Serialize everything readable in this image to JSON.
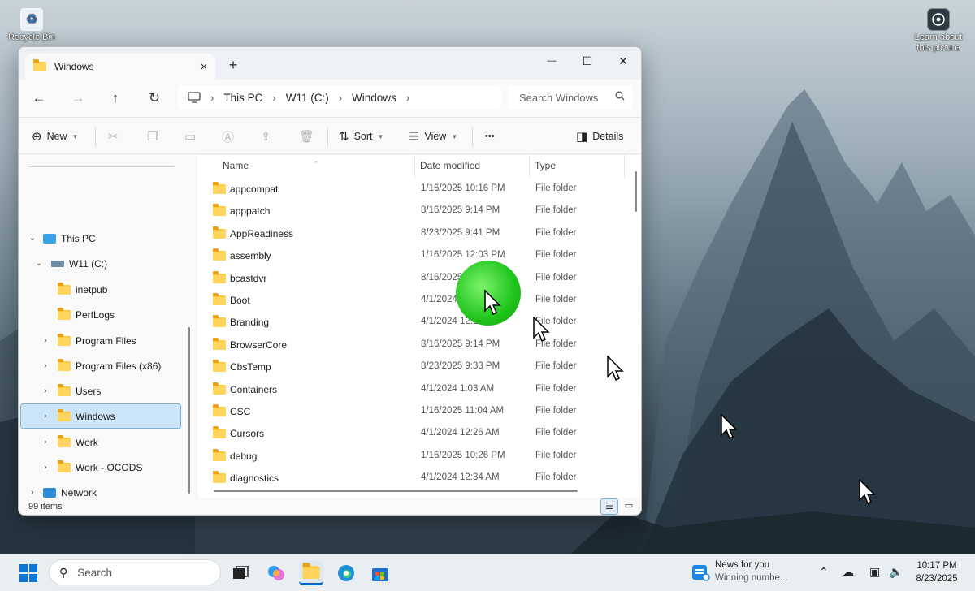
{
  "desktop": {
    "recycle_bin_label": "Recycle Bin",
    "learn_about_label": "Learn about this picture"
  },
  "window": {
    "tab_title": "Windows",
    "new_tab_glyph": "+",
    "tab_close_glyph": "×",
    "minimize_glyph": "—",
    "maximize_glyph": "☐",
    "close_glyph": "✕"
  },
  "nav": {
    "back_glyph": "←",
    "forward_glyph": "→",
    "up_glyph": "↑",
    "refresh_glyph": "↻",
    "breadcrumb": [
      "This PC",
      "W11 (C:)",
      "Windows"
    ],
    "search_placeholder": "Search Windows"
  },
  "toolbar": {
    "new_label": "New",
    "sort_label": "Sort",
    "view_label": "View",
    "more_label": "•••",
    "details_label": "Details"
  },
  "sidebar": {
    "items": [
      {
        "label": "This PC",
        "icon": "pc-icon",
        "expanded": true
      },
      {
        "label": "W11 (C:)",
        "icon": "drive-icon",
        "expanded": true
      },
      {
        "label": "inetpub",
        "icon": "folder-icon"
      },
      {
        "label": "PerfLogs",
        "icon": "folder-icon"
      },
      {
        "label": "Program Files",
        "icon": "folder-icon"
      },
      {
        "label": "Program Files (x86)",
        "icon": "folder-icon"
      },
      {
        "label": "Users",
        "icon": "folder-icon"
      },
      {
        "label": "Windows",
        "icon": "folder-icon",
        "selected": true
      },
      {
        "label": "Work",
        "icon": "folder-icon"
      },
      {
        "label": "Work - OCODS",
        "icon": "folder-icon"
      },
      {
        "label": "Network",
        "icon": "network-icon"
      }
    ]
  },
  "columns": {
    "name": "Name",
    "date": "Date modified",
    "type": "Type"
  },
  "files": [
    {
      "name": "appcompat",
      "date": "1/16/2025 10:16 PM",
      "type": "File folder"
    },
    {
      "name": "apppatch",
      "date": "8/16/2025 9:14 PM",
      "type": "File folder"
    },
    {
      "name": "AppReadiness",
      "date": "8/23/2025 9:41 PM",
      "type": "File folder"
    },
    {
      "name": "assembly",
      "date": "1/16/2025 12:03 PM",
      "type": "File folder"
    },
    {
      "name": "bcastdvr",
      "date": "8/16/2025",
      "type": "File folder"
    },
    {
      "name": "Boot",
      "date": "4/1/2024",
      "type": "File folder"
    },
    {
      "name": "Branding",
      "date": "4/1/2024 12:2",
      "type": "File folder"
    },
    {
      "name": "BrowserCore",
      "date": "8/16/2025 9:14 PM",
      "type": "File folder"
    },
    {
      "name": "CbsTemp",
      "date": "8/23/2025 9:33 PM",
      "type": "File folder"
    },
    {
      "name": "Containers",
      "date": "4/1/2024 1:03 AM",
      "type": "File folder"
    },
    {
      "name": "CSC",
      "date": "1/16/2025 11:04 AM",
      "type": "File folder"
    },
    {
      "name": "Cursors",
      "date": "4/1/2024 12:26 AM",
      "type": "File folder"
    },
    {
      "name": "debug",
      "date": "1/16/2025 10:26 PM",
      "type": "File folder"
    },
    {
      "name": "diagnostics",
      "date": "4/1/2024 12:34 AM",
      "type": "File folder"
    }
  ],
  "status": {
    "item_count": "99 items"
  },
  "taskbar": {
    "search_placeholder": "Search",
    "news_title": "News for you",
    "news_sub": "Winning numbe...",
    "time": "10:17 PM",
    "date": "8/23/2025"
  },
  "colors": {
    "accent": "#0067c0",
    "selection": "#cce4f7",
    "folder": "#ffc83d"
  }
}
